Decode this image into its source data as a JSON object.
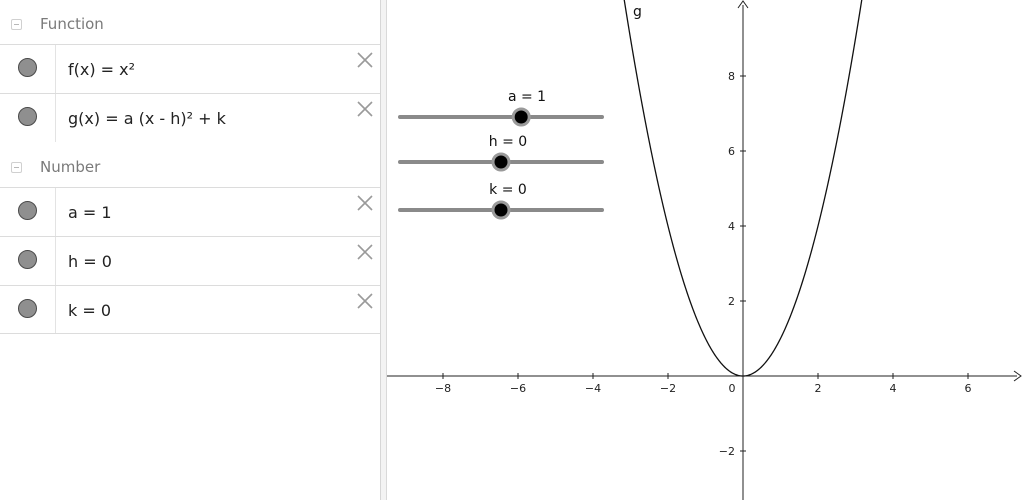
{
  "algebra": {
    "groups": [
      {
        "label": "Function",
        "items": [
          {
            "text": "f(x) = x²"
          },
          {
            "text": "g(x) = a (x - h)² + k"
          }
        ]
      },
      {
        "label": "Number",
        "items": [
          {
            "text": "a = 1"
          },
          {
            "text": "h = 0"
          },
          {
            "text": "k = 0"
          }
        ]
      }
    ]
  },
  "graphics": {
    "curve_label": "g",
    "sliders": [
      {
        "name": "a",
        "label": "a = 1",
        "value": 1,
        "fraction": 0.6
      },
      {
        "name": "h",
        "label": "h = 0",
        "value": 0,
        "fraction": 0.5
      },
      {
        "name": "k",
        "label": "k = 0",
        "value": 0,
        "fraction": 0.5
      }
    ],
    "x_ticks": [
      "−8",
      "−6",
      "−4",
      "−2",
      "0",
      "2",
      "4",
      "6"
    ],
    "y_ticks": [
      "8",
      "6",
      "4",
      "2",
      "−2"
    ]
  },
  "chart_data": {
    "type": "line",
    "series": [
      {
        "name": "g",
        "function": "a (x - h)² + k",
        "a": 1,
        "h": 0,
        "k": 0
      }
    ],
    "xlim": [
      -9.3,
      7.6
    ],
    "ylim": [
      -3.2,
      10.0
    ],
    "x_tick_values": [
      -8,
      -6,
      -4,
      -2,
      0,
      2,
      4,
      6
    ],
    "y_tick_values": [
      -2,
      2,
      4,
      6,
      8
    ],
    "grid": false
  }
}
